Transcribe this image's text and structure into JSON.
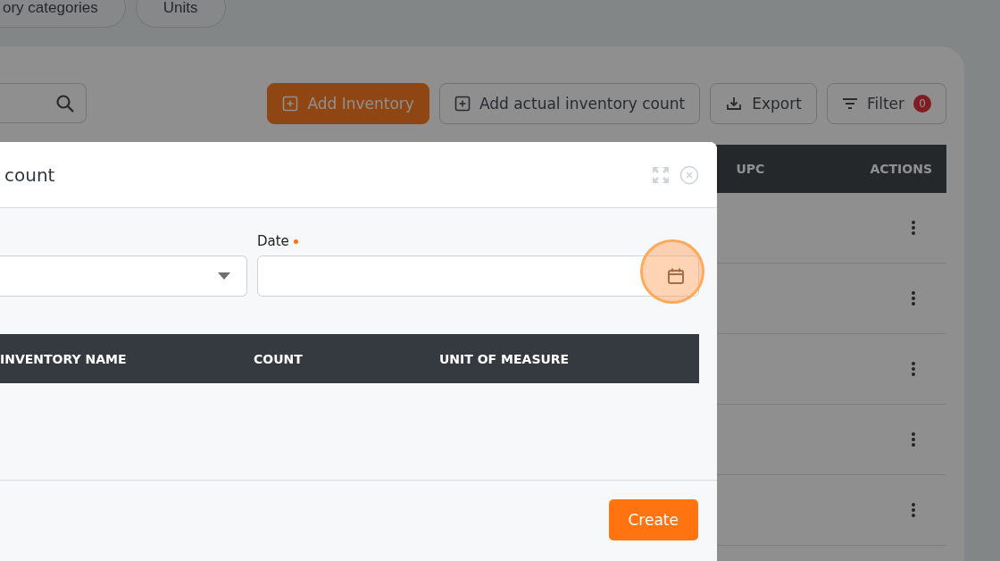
{
  "top_tabs": [
    {
      "label": "ory categories"
    },
    {
      "label": "Units"
    }
  ],
  "buttons": [
    {
      "label": "Add Inventory",
      "kind": "primary"
    },
    {
      "label": "Add actual inventory count",
      "kind": "plus"
    },
    {
      "label": "Export",
      "kind": "export"
    },
    {
      "label": "Filter",
      "kind": "filter",
      "badge": "0"
    }
  ],
  "table": {
    "columns": [
      "UPC",
      "ACTIONS"
    ],
    "rows": [
      {
        "kind": "actions"
      },
      {
        "kind": "actions"
      },
      {
        "kind": "actions"
      },
      {
        "kind": "actions"
      },
      {
        "kind": "actions"
      }
    ]
  },
  "modal": {
    "title": "count",
    "select": {
      "kind": "dropdown"
    },
    "date": {
      "label": "Date",
      "required": true,
      "highlighted": true
    },
    "table": {
      "columns": [
        "INVENTORY NAME",
        "COUNT",
        "UNIT OF MEASURE"
      ]
    },
    "submit": "Create"
  }
}
